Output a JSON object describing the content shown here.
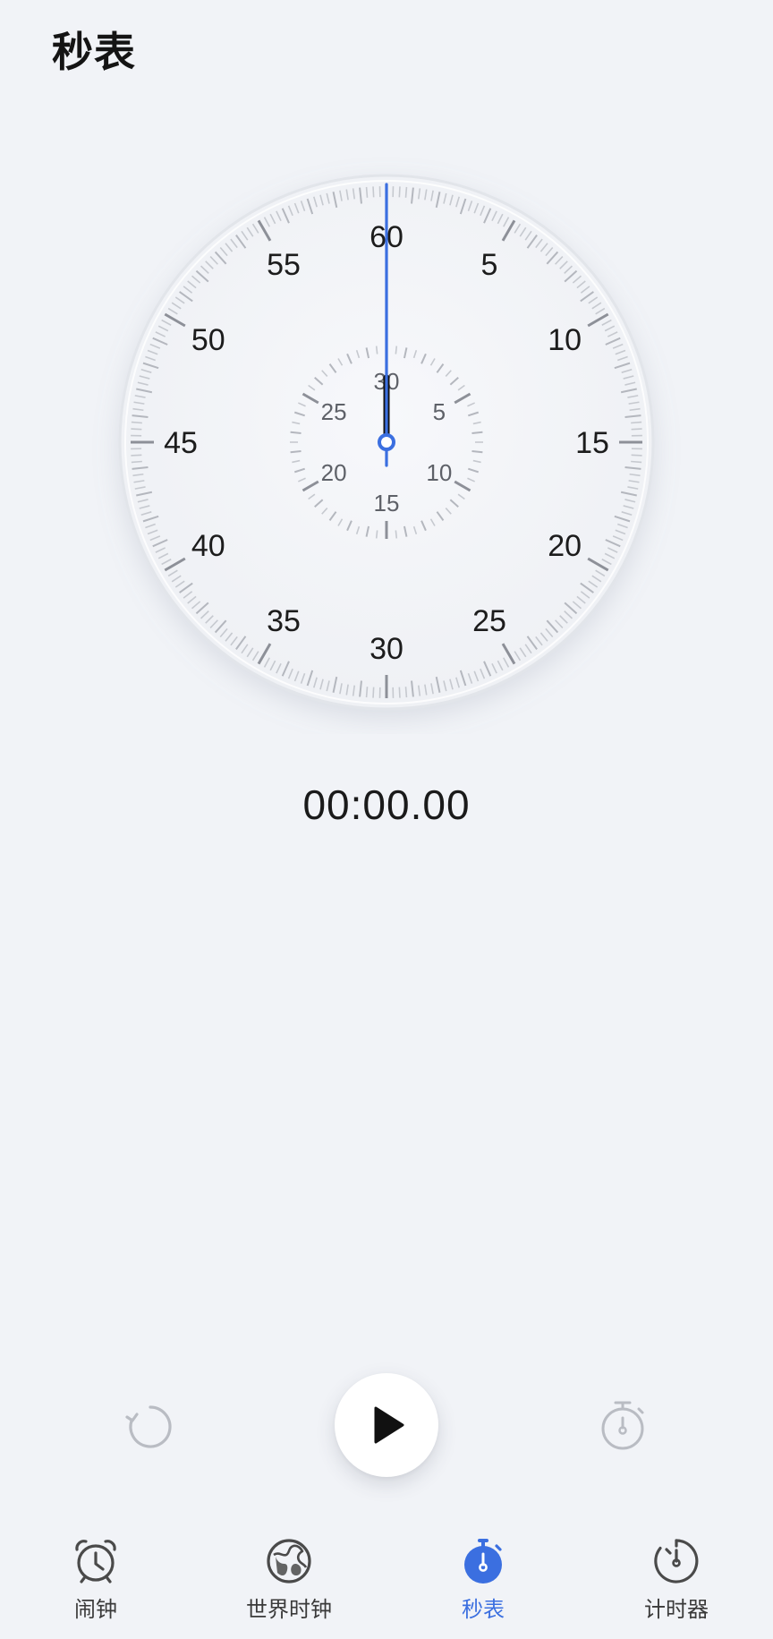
{
  "header": {
    "title": "秒表"
  },
  "stopwatch": {
    "elapsed": "00:00.00",
    "outer_dial_labels": [
      "60",
      "5",
      "10",
      "15",
      "20",
      "25",
      "30",
      "35",
      "40",
      "45",
      "50",
      "55"
    ],
    "inner_dial_labels": [
      "30",
      "5",
      "10",
      "15",
      "20",
      "25"
    ],
    "seconds_hand_value": 0,
    "minutes_hand_value": 0,
    "accent_color": "#3b6fe0"
  },
  "controls": {
    "reset_icon": "reset-icon",
    "start_icon": "play-icon",
    "lap_icon": "lap-stopwatch-icon"
  },
  "tabs": [
    {
      "label": "闹钟",
      "icon": "alarm-clock-icon",
      "active": false
    },
    {
      "label": "世界时钟",
      "icon": "globe-icon",
      "active": false
    },
    {
      "label": "秒表",
      "icon": "stopwatch-icon",
      "active": true
    },
    {
      "label": "计时器",
      "icon": "timer-icon",
      "active": false
    }
  ],
  "colors": {
    "background": "#f1f3f7",
    "active_tab": "#3b6fe0",
    "inactive_tab": "#3a3a3a",
    "disabled_control": "#b9bcc3"
  }
}
